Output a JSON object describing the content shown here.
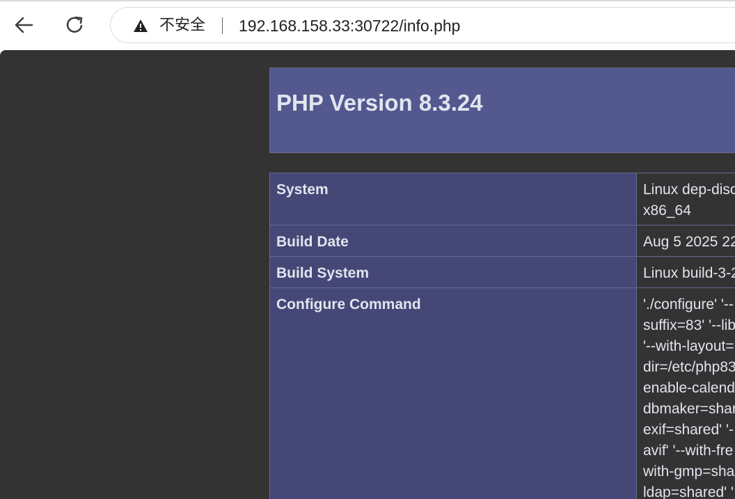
{
  "browser": {
    "security_label": "不安全",
    "url": "192.168.158.33:30722/info.php"
  },
  "page": {
    "title": "PHP Version 8.3.24"
  },
  "table": {
    "rows": [
      {
        "key": "System",
        "value_lines": [
          "Linux dep-disc",
          "x86_64"
        ]
      },
      {
        "key": "Build Date",
        "value_lines": [
          "Aug 5 2025 22:"
        ]
      },
      {
        "key": "Build System",
        "value_lines": [
          "Linux build-3-2"
        ]
      },
      {
        "key": "Configure Command",
        "value_lines": [
          "'./configure' '--",
          "suffix=83' '--lib",
          "'--with-layout=",
          "dir=/etc/php83",
          "enable-calend",
          "dbmaker=shar",
          "exif=shared' '-",
          "avif' '--with-fre",
          "with-gmp=sha",
          "ldap=shared' '"
        ]
      }
    ]
  }
}
